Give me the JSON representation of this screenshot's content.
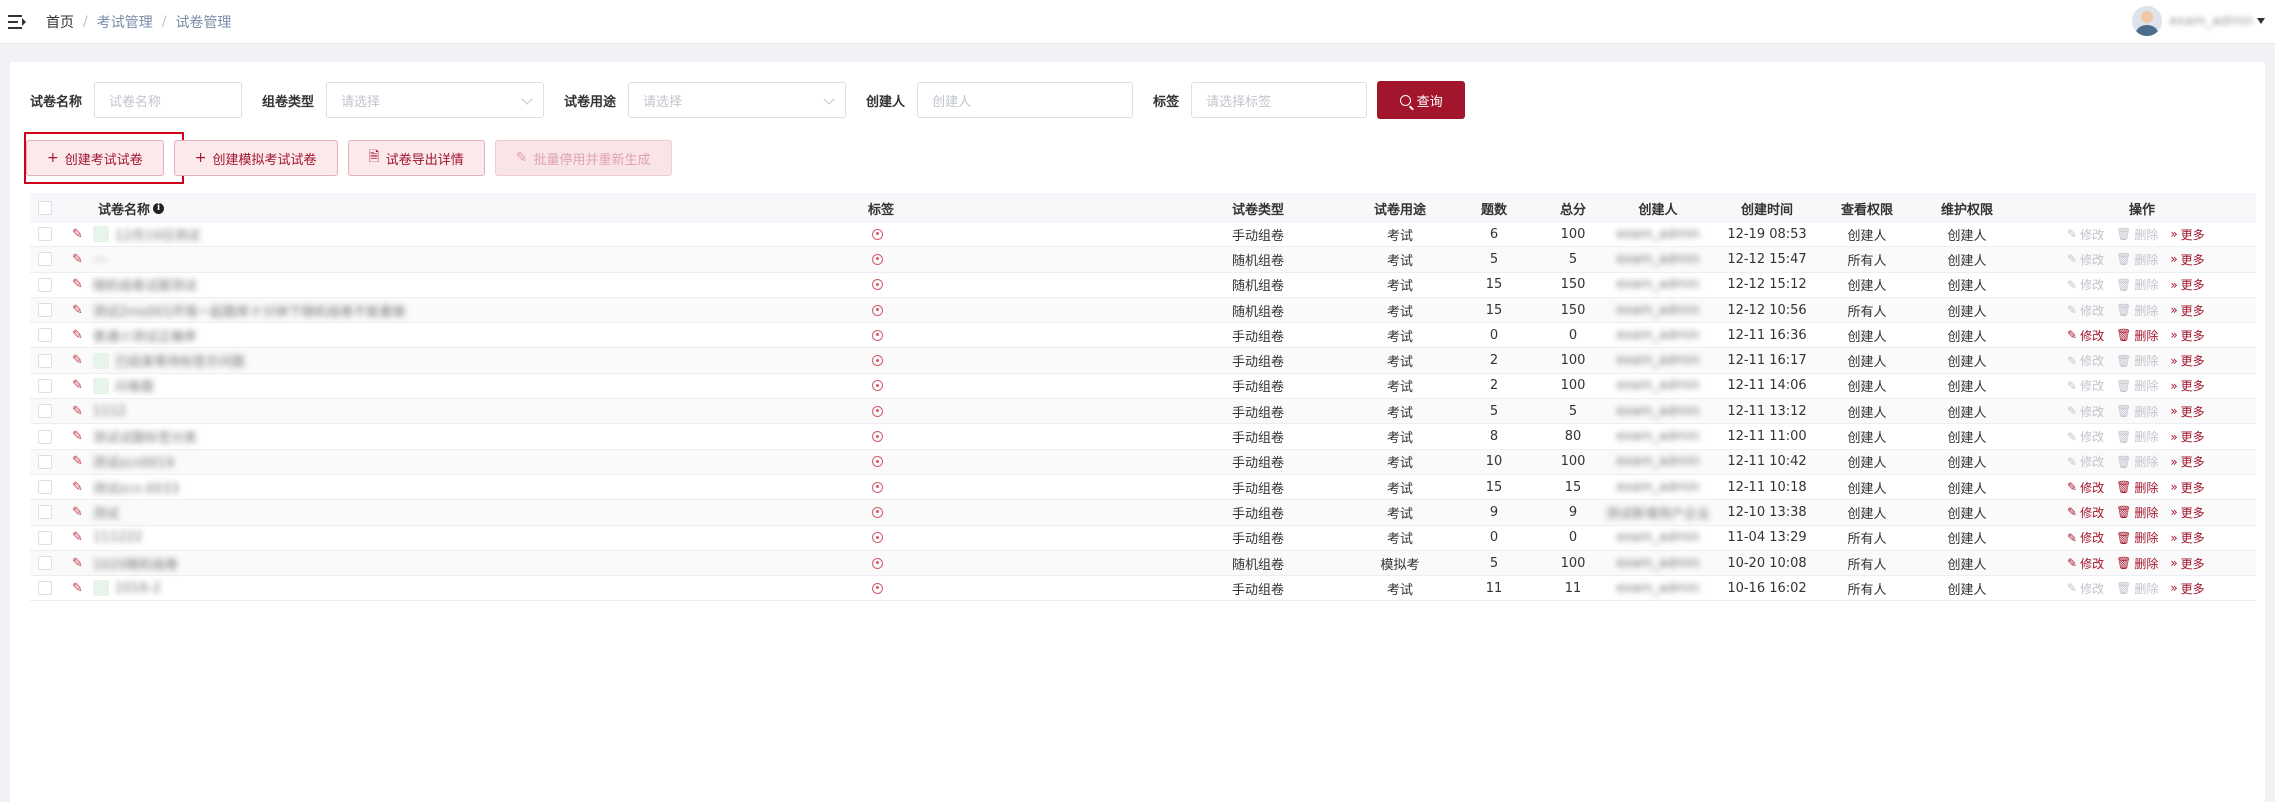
{
  "breadcrumb": {
    "home": "首页",
    "items": [
      "考试管理",
      "试卷管理"
    ]
  },
  "user": {
    "name": "exam_admin"
  },
  "filters": {
    "name_label": "试卷名称",
    "name_placeholder": "试卷名称",
    "type_label": "组卷类型",
    "type_placeholder": "请选择",
    "usage_label": "试卷用途",
    "usage_placeholder": "请选择",
    "creator_label": "创建人",
    "creator_placeholder": "创建人",
    "tag_label": "标签",
    "tag_placeholder": "请选择标签",
    "query_label": "查询"
  },
  "actions": {
    "create_exam": "创建考试试卷",
    "create_mock": "创建模拟考试试卷",
    "export_detail": "试卷导出详情",
    "batch_disable": "批量停用并重新生成"
  },
  "table": {
    "headers": {
      "name": "试卷名称",
      "tag": "标签",
      "type": "试卷类型",
      "usage": "试卷用途",
      "count": "题数",
      "total": "总分",
      "creator": "创建人",
      "created": "创建时间",
      "view": "查看权限",
      "maintain": "维护权限",
      "ops": "操作"
    },
    "op_labels": {
      "edit": "修改",
      "delete": "删除",
      "more": "更多"
    },
    "rows": [
      {
        "name": "12月19日测试",
        "thumb": true,
        "type": "手动组卷",
        "usage": "考试",
        "count": "6",
        "total": "100",
        "creator": "exam_admin",
        "created": "12-19 08:53",
        "view": "创建人",
        "maintain": "创建人",
        "editable": false
      },
      {
        "name": "---",
        "thumb": false,
        "type": "随机组卷",
        "usage": "考试",
        "count": "5",
        "total": "5",
        "creator": "exam_admin",
        "created": "12-12 15:47",
        "view": "所有人",
        "maintain": "创建人",
        "editable": false
      },
      {
        "name": "随机组卷试题测试",
        "thumb": false,
        "type": "随机组卷",
        "usage": "考试",
        "count": "15",
        "total": "150",
        "creator": "exam_admin",
        "created": "12-12 15:12",
        "view": "创建人",
        "maintain": "创建人",
        "editable": false
      },
      {
        "name": "测试2ms001环境一起题库十分钟下随机组卷不能重做",
        "thumb": false,
        "type": "随机组卷",
        "usage": "考试",
        "count": "15",
        "total": "150",
        "creator": "exam_admin",
        "created": "12-12 10:56",
        "view": "所有人",
        "maintain": "创建人",
        "editable": false
      },
      {
        "name": "普通小测试正确率",
        "thumb": false,
        "type": "手动组卷",
        "usage": "考试",
        "count": "0",
        "total": "0",
        "creator": "exam_admin",
        "created": "12-11 16:36",
        "view": "创建人",
        "maintain": "创建人",
        "editable": true
      },
      {
        "name": "已结束等待标签示问题",
        "thumb": true,
        "type": "手动组卷",
        "usage": "考试",
        "count": "2",
        "total": "100",
        "creator": "exam_admin",
        "created": "12-11 16:17",
        "view": "创建人",
        "maintain": "创建人",
        "editable": false
      },
      {
        "name": "问卷题",
        "thumb": true,
        "type": "手动组卷",
        "usage": "考试",
        "count": "2",
        "total": "100",
        "creator": "exam_admin",
        "created": "12-11 14:06",
        "view": "创建人",
        "maintain": "创建人",
        "editable": false
      },
      {
        "name": "1112",
        "thumb": false,
        "type": "手动组卷",
        "usage": "考试",
        "count": "5",
        "total": "5",
        "creator": "exam_admin",
        "created": "12-11 13:12",
        "view": "创建人",
        "maintain": "创建人",
        "editable": false
      },
      {
        "name": "测试试题标签分类",
        "thumb": false,
        "type": "手动组卷",
        "usage": "考试",
        "count": "8",
        "total": "80",
        "creator": "exam_admin",
        "created": "12-11 11:00",
        "view": "创建人",
        "maintain": "创建人",
        "editable": false
      },
      {
        "name": "测试zcn0019",
        "thumb": false,
        "type": "手动组卷",
        "usage": "考试",
        "count": "10",
        "total": "100",
        "creator": "exam_admin",
        "created": "12-11 10:42",
        "view": "创建人",
        "maintain": "创建人",
        "editable": false
      },
      {
        "name": "测试zcn-0033",
        "thumb": false,
        "type": "手动组卷",
        "usage": "考试",
        "count": "15",
        "total": "15",
        "creator": "exam_admin",
        "created": "12-11 10:18",
        "view": "创建人",
        "maintain": "创建人",
        "editable": true
      },
      {
        "name": "测试",
        "thumb": false,
        "type": "手动组卷",
        "usage": "考试",
        "count": "9",
        "total": "9",
        "creator": "测试新增用户企业",
        "created": "12-10 13:38",
        "view": "创建人",
        "maintain": "创建人",
        "editable": true
      },
      {
        "name": "111222",
        "thumb": false,
        "type": "手动组卷",
        "usage": "考试",
        "count": "0",
        "total": "0",
        "creator": "exam_admin",
        "created": "11-04 13:29",
        "view": "所有人",
        "maintain": "创建人",
        "editable": true
      },
      {
        "name": "1020随机组卷",
        "thumb": false,
        "type": "随机组卷",
        "usage": "模拟考",
        "count": "5",
        "total": "100",
        "creator": "exam_admin",
        "created": "10-20 10:08",
        "view": "所有人",
        "maintain": "创建人",
        "editable": true
      },
      {
        "name": "1016-2",
        "thumb": true,
        "type": "手动组卷",
        "usage": "考试",
        "count": "11",
        "total": "11",
        "creator": "exam_admin",
        "created": "10-16 16:02",
        "view": "所有人",
        "maintain": "创建人",
        "editable": false
      }
    ]
  }
}
